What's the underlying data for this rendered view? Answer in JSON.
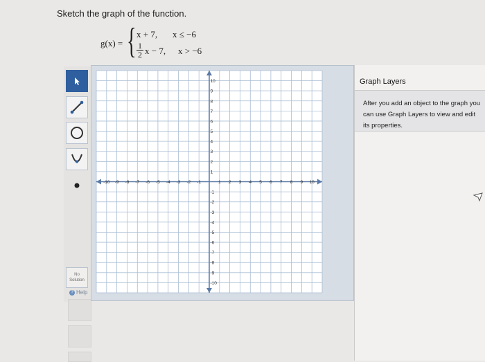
{
  "prompt": "Sketch the graph of the function.",
  "equation": {
    "lhs": "g(x) =",
    "case1_expr": "x + 7,",
    "case1_cond": "x ≤ −6",
    "case2_num": "1",
    "case2_den": "2",
    "case2_expr": "x − 7,",
    "case2_cond": "x > −6"
  },
  "toolbar": {
    "tools": [
      {
        "name": "select-tool",
        "icon": "arrow-pointer-icon",
        "active": true
      },
      {
        "name": "line-tool",
        "icon": "line-icon",
        "active": false
      },
      {
        "name": "circle-tool",
        "icon": "circle-icon",
        "active": false
      },
      {
        "name": "parabola-tool",
        "icon": "parabola-icon",
        "active": false
      },
      {
        "name": "point-tool",
        "icon": "point-icon",
        "active": false
      }
    ],
    "no_solution": "No Solution",
    "help": "Help"
  },
  "graph": {
    "x_ticks": [
      "-10",
      "-9",
      "-8",
      "-7",
      "-6",
      "-5",
      "-4",
      "-3",
      "-2",
      "-1",
      "1",
      "2",
      "3",
      "4",
      "5",
      "6",
      "7",
      "8",
      "9",
      "10"
    ],
    "y_ticks": [
      "10",
      "9",
      "8",
      "7",
      "6",
      "5",
      "4",
      "3",
      "2",
      "1",
      "-1",
      "-2",
      "-3",
      "-4",
      "-5",
      "-6",
      "-7",
      "-8",
      "-9",
      "-10"
    ],
    "xlim": [
      -10,
      10
    ],
    "ylim": [
      -10,
      10
    ],
    "grid_color": "#a9bdd3",
    "axis_color": "#5a7aa6"
  },
  "panel": {
    "title": "Graph Layers",
    "message": "After you add an object to the graph you can use Graph Layers to view and edit its properties."
  },
  "colors": {
    "active_tool": "#2f5f9e",
    "page_bg": "#e9e8e6"
  }
}
